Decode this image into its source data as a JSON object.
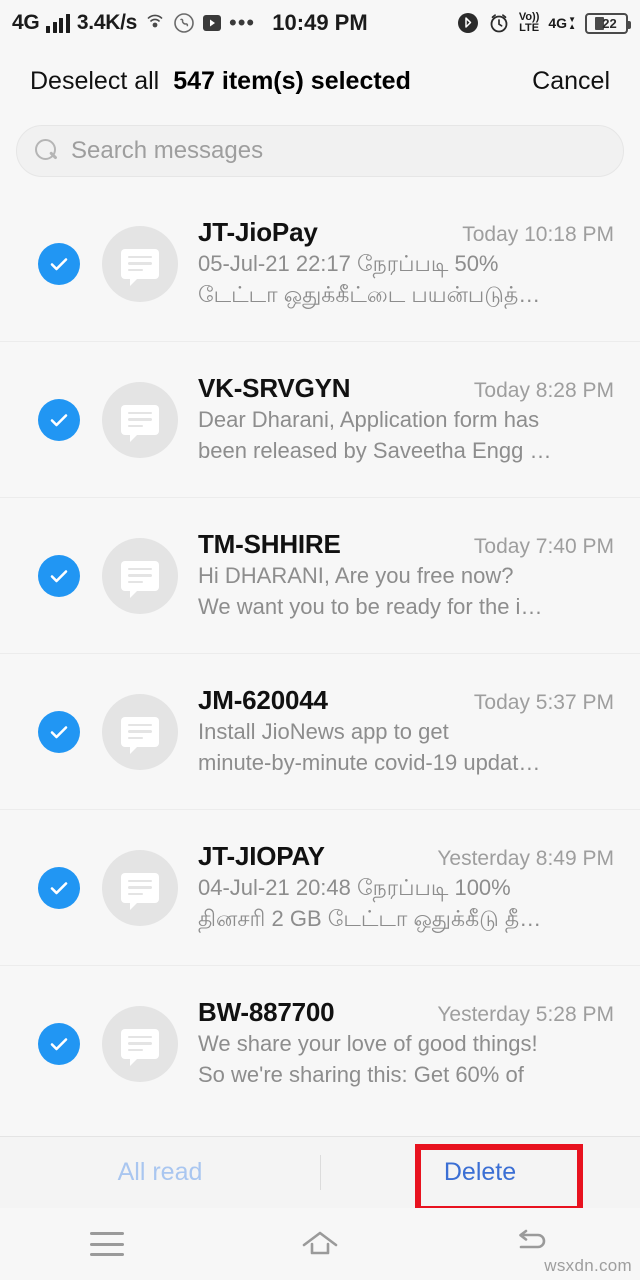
{
  "statusbar": {
    "network_label": "4G",
    "data_rate": "3.4K/s",
    "time": "10:49 PM",
    "volte_top": "Vo))",
    "volte_bottom": "LTE",
    "net_badge": "4G",
    "battery_percent": "22",
    "icons": [
      "signal-bars-icon",
      "hotspot-icon",
      "whatsapp-icon",
      "video-player-icon",
      "overflow-dots-icon",
      "bluetooth-icon",
      "alarm-icon",
      "volte-icon",
      "data-arrows-icon",
      "battery-icon"
    ]
  },
  "selection_header": {
    "deselect_all": "Deselect all",
    "count_label": "547 item(s) selected",
    "cancel": "Cancel"
  },
  "search": {
    "placeholder": "Search messages",
    "value": ""
  },
  "messages": [
    {
      "sender": "JT-JioPay",
      "timestamp": "Today 10:18 PM",
      "preview_line1": "05-Jul-21 22:17 நேரப்படி 50%",
      "preview_line2": "டேட்டா ஒதுக்கீட்டை பயன்படுத்…",
      "selected": true
    },
    {
      "sender": "VK-SRVGYN",
      "timestamp": "Today 8:28 PM",
      "preview_line1": "Dear Dharani, Application form has",
      "preview_line2": "been released by Saveetha Engg …",
      "selected": true
    },
    {
      "sender": "TM-SHHIRE",
      "timestamp": "Today 7:40 PM",
      "preview_line1": "Hi DHARANI, Are you free now?",
      "preview_line2": "We want you to be ready for the i…",
      "selected": true
    },
    {
      "sender": "JM-620044",
      "timestamp": "Today 5:37 PM",
      "preview_line1": "Install JioNews app to get",
      "preview_line2": "minute-by-minute covid-19 updat…",
      "selected": true
    },
    {
      "sender": "JT-JIOPAY",
      "timestamp": "Yesterday 8:49 PM",
      "preview_line1": "04-Jul-21 20:48 நேரப்படி 100%",
      "preview_line2": "தினசரி 2 GB டேட்டா ஒதுக்கீடு தீ…",
      "selected": true
    },
    {
      "sender": "BW-887700",
      "timestamp": "Yesterday 5:28 PM",
      "preview_line1": "We share your love of good things!",
      "preview_line2": "So we're sharing this: Get 60% of",
      "selected": true
    }
  ],
  "action_bar": {
    "all_read": "All read",
    "delete": "Delete"
  },
  "navbar": {
    "menu": "menu-icon",
    "home": "home-icon",
    "back": "back-icon"
  },
  "watermark": "wsxdn.com",
  "colors": {
    "accent_blue": "#2196f3",
    "delete_blue": "#3b6fd4",
    "allread_blue": "#a9c6f0",
    "highlight_red": "#e8121f",
    "background": "#f7f7f7"
  }
}
